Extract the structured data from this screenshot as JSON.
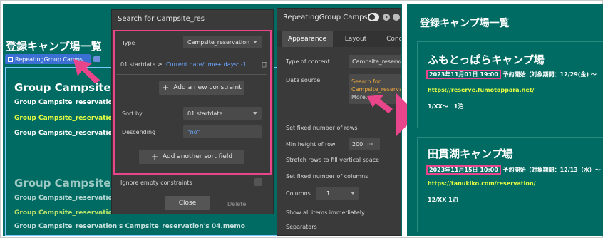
{
  "canvas": {
    "title": "登録キャンプ場一覧",
    "repeating_group_chip": "RepeatingGroup Camps...",
    "cell1": {
      "group_title": "Group Campsite_r",
      "line1": "Group Campsite_reservation's",
      "line2": "Group Campsite_reservation's",
      "line3": "Group Campsite_reservation's"
    },
    "cell2": {
      "group_title": "Group Campsite_r",
      "line1": "Group Campsite_reservation's",
      "line2": "Group Campsite_reservation's",
      "line3": "Group Campsite_reservation's Campsite_reservation's 04.memo"
    }
  },
  "search_popup": {
    "title": "Search for Campsite_res",
    "type_label": "Type",
    "type_value": "Campsite_reservation",
    "constraint_field": "01.startdate ≥",
    "constraint_value": "Current date/time+ days: -1",
    "add_constraint": "Add a new constraint",
    "sort_by_label": "Sort by",
    "sort_by_value": "01.startdate",
    "descending_label": "Descending",
    "descending_value": "\"no\"",
    "add_sort": "Add another sort field",
    "ignore_empty": "Ignore empty constraints",
    "close": "Close",
    "delete": "Delete"
  },
  "property_editor": {
    "title": "RepeatingGroup Campsi",
    "tabs": [
      "Appearance",
      "Layout",
      "Condi"
    ],
    "type_of_content_label": "Type of content",
    "type_of_content_value": "Campsite_reservatio",
    "data_source_label": "Data source",
    "data_source_value": "Search for Campsite_reservatio",
    "data_source_more": "More...",
    "fixed_rows_label": "Set fixed number of rows",
    "min_height_label": "Min height of row",
    "min_height_value": "200",
    "min_height_unit": "px",
    "stretch_label": "Stretch rows to fill vertical space",
    "fixed_cols_label": "Set fixed number of columns",
    "columns_label": "Columns",
    "columns_value": "1",
    "show_all_label": "Show all items immediately",
    "separators_label": "Separators"
  },
  "preview": {
    "title": "登録キャンプ場一覧",
    "cards": [
      {
        "name": "ふもとっぱらキャンプ場",
        "date": "2023年11月01日 19:00",
        "date_rest": "予約開始（対象期間：12/29(金) ～",
        "url": "https://reserve.fumotoppara.net/",
        "note": "1/XX〜　1泊"
      },
      {
        "name": "田貫湖キャンプ場",
        "date": "2023年11月15日 10:00",
        "date_rest": "予約開始（対象期間：12/13（水）～",
        "url": "https://tanukiko.com/reservation/",
        "note": "12/XX 1泊"
      }
    ]
  },
  "colors": {
    "teal": "#006b62",
    "pink_highlight": "#e8458b",
    "yellow_text": "#e8ff43",
    "panel_dark": "#3a3a3a",
    "chip_blue": "#3b6fd4"
  }
}
